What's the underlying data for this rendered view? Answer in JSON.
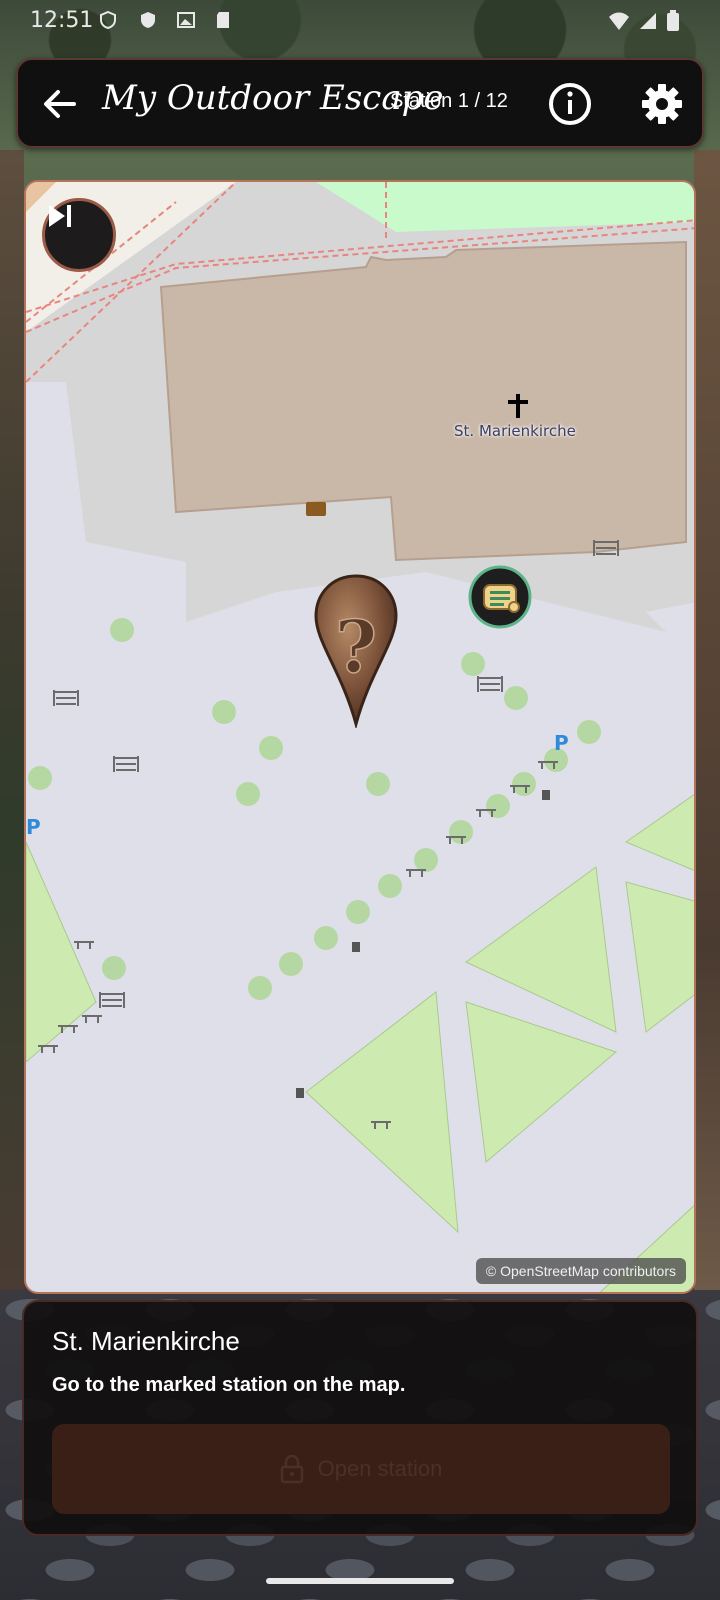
{
  "status_bar": {
    "time": "12:51"
  },
  "app_bar": {
    "title": "My Outdoor Escape",
    "station_counter": "Station 1 / 12"
  },
  "map": {
    "place_label": "St. Marienkirche",
    "attribution": "© OpenStreetMap contributors"
  },
  "station_card": {
    "title": "St. Marienkirche",
    "description": "Go to the marked station on the map.",
    "open_button_label": "Open station",
    "open_button_enabled": false
  },
  "colors": {
    "accent_border": "#b4745a",
    "panel_bg": "#101010",
    "button_disabled_bg": "#3a1f16"
  },
  "icons": [
    "back-arrow-icon",
    "info-icon",
    "gear-icon",
    "skip-next-icon",
    "question-pin-icon",
    "scroll-marker-icon",
    "lock-icon",
    "church-cross-icon"
  ]
}
